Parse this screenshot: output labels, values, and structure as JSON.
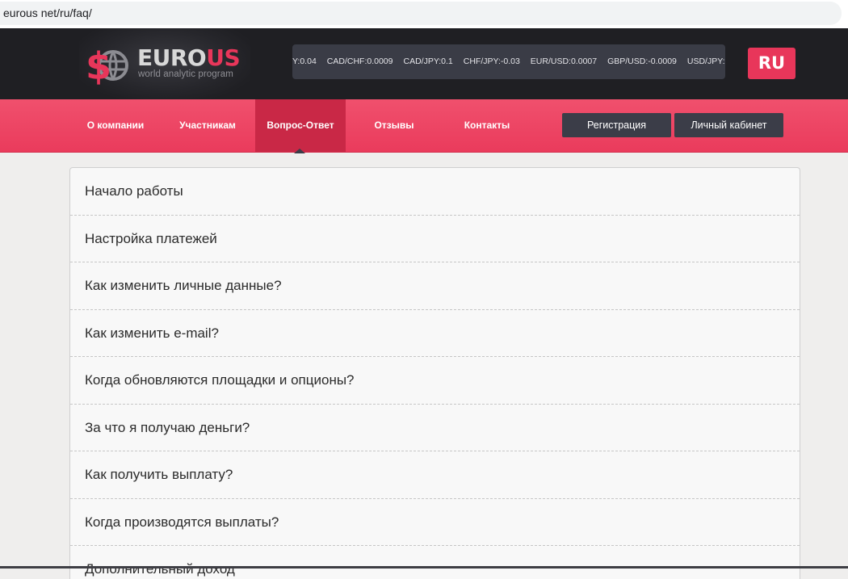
{
  "browser": {
    "url": "eurous net/ru/faq/"
  },
  "header": {
    "logo": {
      "name_part1": "EURO",
      "name_part2": "US",
      "tagline": "world analytic program"
    },
    "ticker": [
      "Y:0.04",
      "CAD/CHF:0.0009",
      "CAD/JPY:0.1",
      "CHF/JPY:-0.03",
      "EUR/USD:0.0007",
      "GBP/USD:-0.0009",
      "USD/JPY:-"
    ],
    "language": "RU"
  },
  "nav": {
    "items": [
      {
        "label": "О компании",
        "active": false
      },
      {
        "label": "Участникам",
        "active": false
      },
      {
        "label": "Вопрос-Ответ",
        "active": true
      },
      {
        "label": "Отзывы",
        "active": false
      },
      {
        "label": "Контакты",
        "active": false
      }
    ],
    "register_label": "Регистрация",
    "cabinet_label": "Личный кабинет"
  },
  "faq": {
    "items": [
      "Начало работы",
      "Настройка платежей",
      "Как изменить личные данные?",
      "Как изменить e-mail?",
      "Когда обновляются площадки и опционы?",
      "За что я получаю деньги?",
      "Как получить выплату?",
      "Когда производятся выплаты?",
      "Дополнительный доход"
    ]
  },
  "colors": {
    "accent": "#e8365a",
    "dark": "#1f1f23",
    "button_dark": "#3b3d48"
  }
}
